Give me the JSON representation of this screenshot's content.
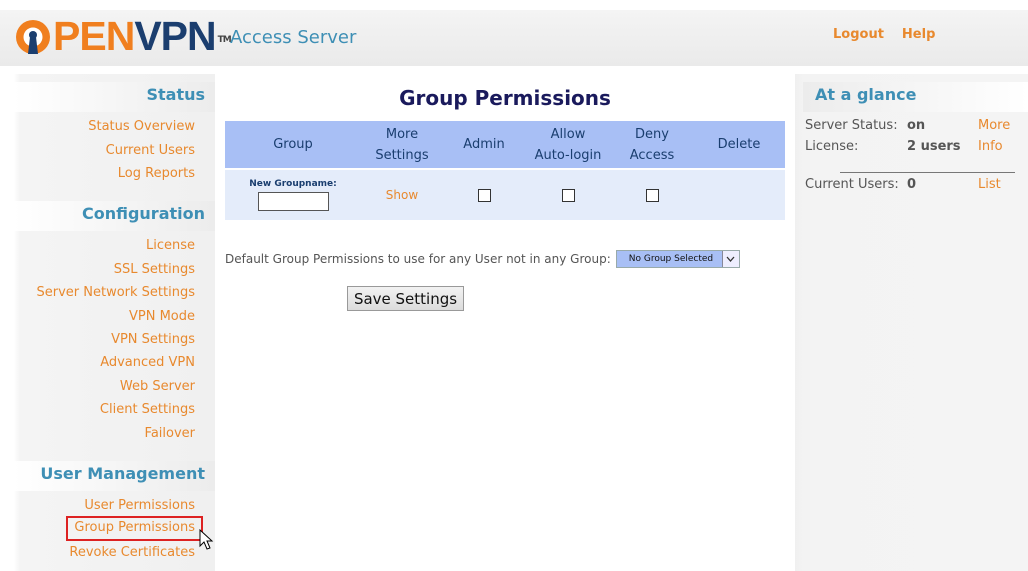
{
  "header": {
    "logo_pen": "PEN",
    "logo_vpn": "VPN",
    "logo_tm": "TM",
    "product": "Access Server",
    "links": {
      "logout": "Logout",
      "help": "Help"
    }
  },
  "sidebar": {
    "sections": [
      {
        "heading": "Status",
        "items": [
          "Status Overview",
          "Current Users",
          "Log Reports"
        ]
      },
      {
        "heading": "Configuration",
        "items": [
          "License",
          "SSL Settings",
          "Server Network Settings",
          "VPN Mode",
          "VPN Settings",
          "Advanced VPN",
          "Web Server",
          "Client Settings",
          "Failover"
        ]
      },
      {
        "heading": "User Management",
        "items": [
          "User Permissions",
          "Group Permissions",
          "Revoke Certificates"
        ]
      }
    ],
    "selected_item": "Group Permissions"
  },
  "main": {
    "title": "Group Permissions",
    "table": {
      "headers": {
        "group": "Group",
        "more_settings_1": "More",
        "more_settings_2": "Settings",
        "admin": "Admin",
        "allow_1": "Allow",
        "allow_2": "Auto-login",
        "deny_1": "Deny",
        "deny_2": "Access",
        "delete": "Delete"
      },
      "new_row": {
        "label": "New Groupname:",
        "value": "",
        "show": "Show"
      }
    },
    "default_label": "Default Group Permissions to use for any User not in any Group:",
    "default_select": "No Group Selected",
    "save_label": "Save Settings"
  },
  "glance": {
    "heading": "At a glance",
    "server_status_label": "Server Status:",
    "server_status_value": "on",
    "license_label": "License:",
    "license_value": "2 users",
    "more_link": "More",
    "info_link": "Info",
    "current_users_label": "Current Users:",
    "current_users_value": "0",
    "list_link": "List"
  },
  "colors": {
    "orange": "#e8892e",
    "heading_blue": "#3e8fb5",
    "navy": "#1a3e6f",
    "table_header": "#a8bff5",
    "table_row": "#e4ecfa"
  }
}
